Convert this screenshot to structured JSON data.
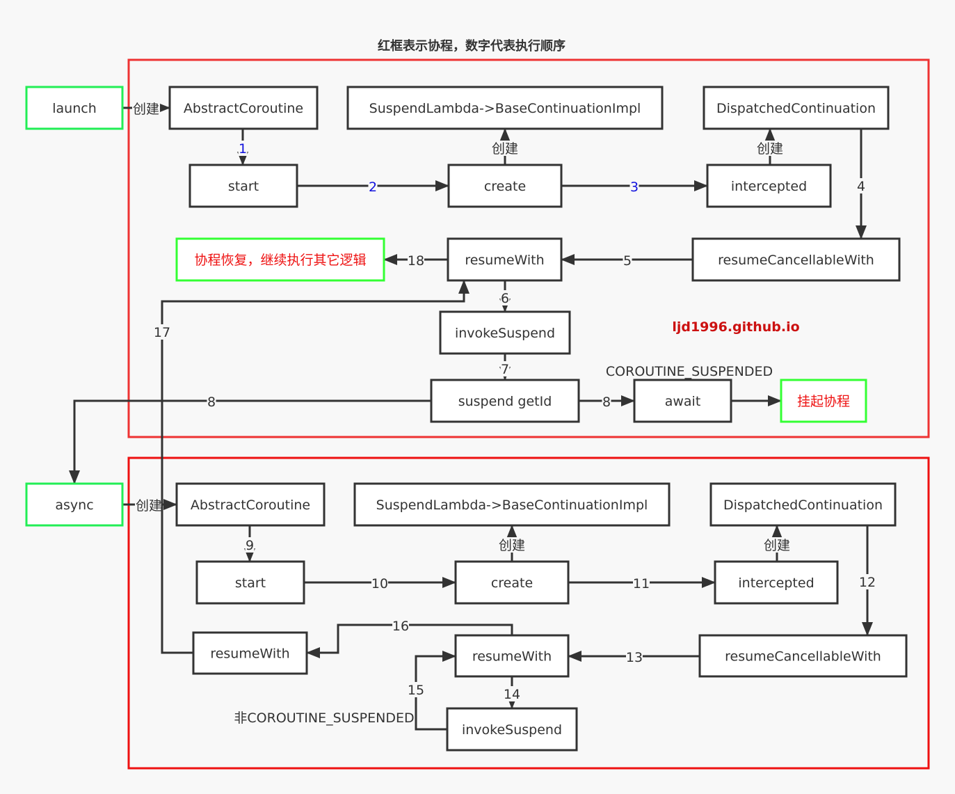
{
  "title": "红框表示协程，数字代表执行顺序",
  "watermark": "ljd1996.github.io",
  "colors": {
    "frame": "#ee3333",
    "frame2": "#ee1111",
    "node_border": "#333333",
    "green_border": "#22ee55",
    "red_text": "#ee1111",
    "blue_label": "#1111dd"
  },
  "frames": [
    {
      "id": "launch-coroutine-frame"
    },
    {
      "id": "async-coroutine-frame"
    }
  ],
  "nodes": [
    {
      "id": "launch",
      "label": "launch",
      "style": "green"
    },
    {
      "id": "ac1",
      "label": "AbstractCoroutine"
    },
    {
      "id": "sl1",
      "label": "SuspendLambda->BaseContinuationImpl"
    },
    {
      "id": "dc1",
      "label": "DispatchedContinuation"
    },
    {
      "id": "start1",
      "label": "start"
    },
    {
      "id": "create1",
      "label": "create"
    },
    {
      "id": "intercepted1",
      "label": "intercepted"
    },
    {
      "id": "resume-result",
      "label": "协程恢复，继续执行其它逻辑",
      "style": "green-red"
    },
    {
      "id": "resumeWith1",
      "label": "resumeWith"
    },
    {
      "id": "rcw1",
      "label": "resumeCancellableWith"
    },
    {
      "id": "invoke1",
      "label": "invokeSuspend"
    },
    {
      "id": "getId",
      "label": "suspend getId"
    },
    {
      "id": "await",
      "label": "await"
    },
    {
      "id": "suspend-result",
      "label": "挂起协程",
      "style": "green-red"
    },
    {
      "id": "async",
      "label": "async",
      "style": "green"
    },
    {
      "id": "ac2",
      "label": "AbstractCoroutine"
    },
    {
      "id": "sl2",
      "label": "SuspendLambda->BaseContinuationImpl"
    },
    {
      "id": "dc2",
      "label": "DispatchedContinuation"
    },
    {
      "id": "start2",
      "label": "start"
    },
    {
      "id": "create2",
      "label": "create"
    },
    {
      "id": "intercepted2",
      "label": "intercepted"
    },
    {
      "id": "resumeWithOuter",
      "label": "resumeWith"
    },
    {
      "id": "resumeWith2",
      "label": "resumeWith"
    },
    {
      "id": "rcw2",
      "label": "resumeCancellableWith"
    },
    {
      "id": "invoke2",
      "label": "invokeSuspend"
    }
  ],
  "edges": [
    {
      "id": "e-launch-create",
      "from": "launch",
      "to": "ac1",
      "label": "创建"
    },
    {
      "id": "e1",
      "from": "ac1",
      "to": "start1",
      "label": "1",
      "color": "blue"
    },
    {
      "id": "e2",
      "from": "start1",
      "to": "create1",
      "label": "2",
      "color": "blue"
    },
    {
      "id": "e-create-sl1",
      "from": "create1",
      "to": "sl1",
      "label": "创建"
    },
    {
      "id": "e3",
      "from": "create1",
      "to": "intercepted1",
      "label": "3",
      "color": "blue"
    },
    {
      "id": "e-int-dc1",
      "from": "intercepted1",
      "to": "dc1",
      "label": "创建"
    },
    {
      "id": "e4",
      "from": "dc1",
      "to": "rcw1",
      "label": "4"
    },
    {
      "id": "e5",
      "from": "rcw1",
      "to": "resumeWith1",
      "label": "5"
    },
    {
      "id": "e6",
      "from": "resumeWith1",
      "to": "invoke1",
      "label": "6"
    },
    {
      "id": "e7",
      "from": "invoke1",
      "to": "getId",
      "label": "7"
    },
    {
      "id": "e8a",
      "from": "getId",
      "to": "await",
      "label": "8"
    },
    {
      "id": "e8b",
      "from": "getId",
      "to": "async",
      "label": "8"
    },
    {
      "id": "e-await-suspend",
      "from": "await",
      "to": "suspend-result",
      "label": ""
    },
    {
      "id": "e18",
      "from": "resumeWith1",
      "to": "resume-result",
      "label": "18"
    },
    {
      "id": "e-async-create",
      "from": "async",
      "to": "ac2",
      "label": "创建"
    },
    {
      "id": "e9",
      "from": "ac2",
      "to": "start2",
      "label": "9"
    },
    {
      "id": "e10",
      "from": "start2",
      "to": "create2",
      "label": "10"
    },
    {
      "id": "e-create-sl2",
      "from": "create2",
      "to": "sl2",
      "label": "创建"
    },
    {
      "id": "e11",
      "from": "create2",
      "to": "intercepted2",
      "label": "11"
    },
    {
      "id": "e-int-dc2",
      "from": "intercepted2",
      "to": "dc2",
      "label": "创建"
    },
    {
      "id": "e12",
      "from": "dc2",
      "to": "rcw2",
      "label": "12"
    },
    {
      "id": "e13",
      "from": "rcw2",
      "to": "resumeWith2",
      "label": "13"
    },
    {
      "id": "e14",
      "from": "resumeWith2",
      "to": "invoke2",
      "label": "14"
    },
    {
      "id": "e15",
      "from": "invoke2",
      "to": "resumeWith2",
      "label": "15"
    },
    {
      "id": "e16",
      "from": "resumeWith2",
      "to": "resumeWithOuter",
      "label": "16"
    },
    {
      "id": "e17",
      "from": "resumeWithOuter",
      "to": "resumeWith1",
      "label": "17"
    }
  ],
  "free_labels": [
    {
      "id": "await-condition",
      "text": "COROUTINE_SUSPENDED"
    },
    {
      "id": "invoke-condition",
      "text": "非COROUTINE_SUSPENDED"
    }
  ]
}
